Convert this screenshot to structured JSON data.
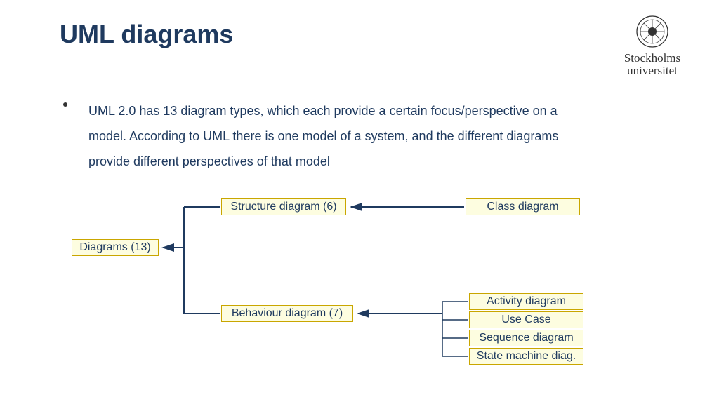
{
  "title": "UML diagrams",
  "logo": {
    "line1": "Stockholms",
    "line2": "universitet"
  },
  "bullet": "UML 2.0 has 13 diagram types, which each provide a certain focus/perspective on a model. According to UML there is one model of a system, and the different diagrams provide different perspectives of that model",
  "nodes": {
    "root": "Diagrams (13)",
    "structure": "Structure diagram (6)",
    "behaviour": "Behaviour diagram (7)",
    "class": "Class diagram",
    "activity": "Activity diagram",
    "usecase": "Use Case",
    "sequence": "Sequence diagram",
    "state": "State machine diag."
  },
  "colors": {
    "line": "#1f3a5f",
    "box_fill": "#fdfde0",
    "box_border": "#c9a600"
  }
}
